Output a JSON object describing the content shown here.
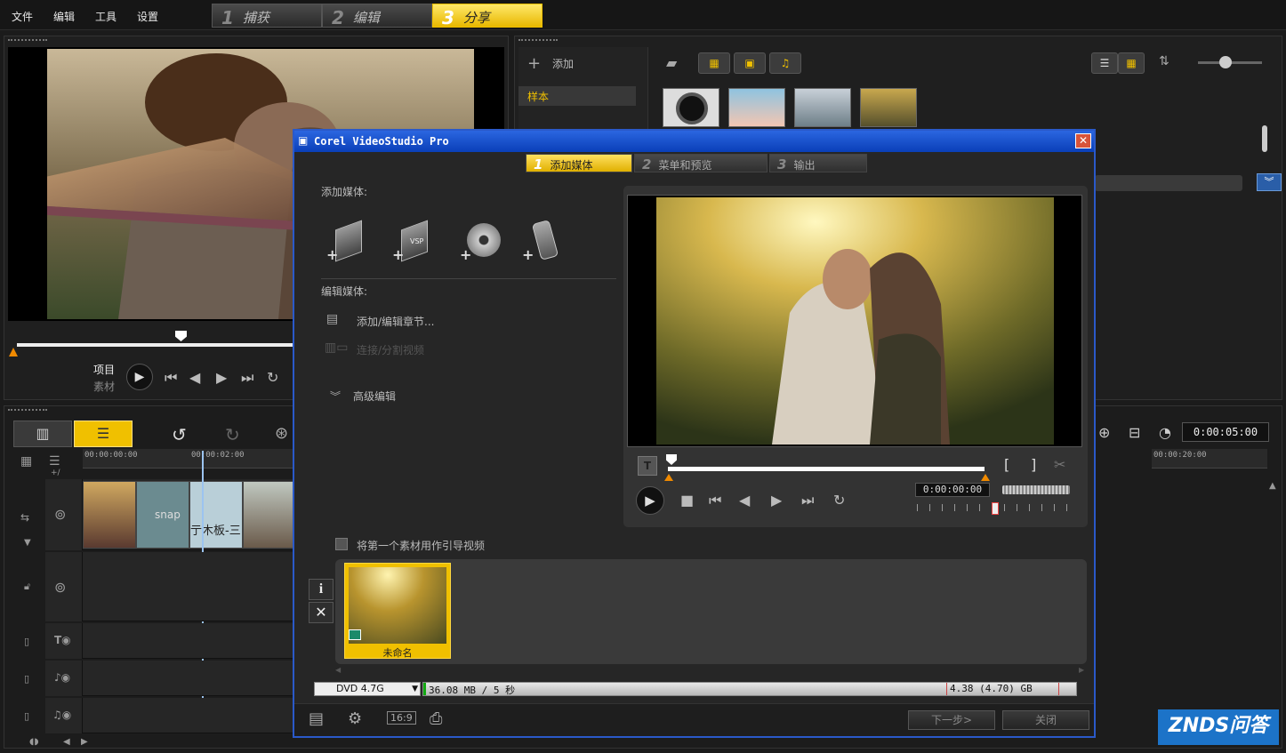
{
  "menubar": {
    "items": [
      "文件",
      "编辑",
      "工具",
      "设置"
    ]
  },
  "steps": [
    {
      "num": "1",
      "label": "捕获"
    },
    {
      "num": "2",
      "label": "编辑"
    },
    {
      "num": "3",
      "label": "分享"
    }
  ],
  "library": {
    "add_label": "添加",
    "folder_label": "样本"
  },
  "player": {
    "project_label": "项目",
    "clip_label": "素材",
    "timecode": "0:00:05:00"
  },
  "timeline": {
    "ruler": [
      "00:00:00:00",
      "00:00:02:00",
      "00:00:20:00"
    ],
    "clip_text_1": "snap",
    "clip_text_2": "亍木板-三",
    "overlay_label": "+/",
    "track_icons": [
      "video-track-icon",
      "overlay-track-icon",
      "title-track-icon",
      "voice-track-icon",
      "music-track-icon"
    ]
  },
  "dialog": {
    "title": "Corel VideoStudio Pro",
    "tabs": [
      {
        "num": "1",
        "label": "添加媒体"
      },
      {
        "num": "2",
        "label": "菜单和预览"
      },
      {
        "num": "3",
        "label": "输出"
      }
    ],
    "add_media_label": "添加媒体:",
    "edit_media_label": "编辑媒体:",
    "chapter_label": "添加/编辑章节...",
    "join_label": "连接/分割视频",
    "advanced_label": "高级编辑",
    "checkbox_label": "将第一个素材用作引导视频",
    "timecode": "0:00:00:00",
    "clip_name": "未命名",
    "disc_type": "DVD 4.7G",
    "usage": "36.08 MB / 5 秒",
    "capacity": "4.38 (4.70) GB",
    "next_label": "下一步>",
    "close_label": "关闭",
    "info_label": "i"
  },
  "watermark": "ZNDS问答",
  "colors": {
    "accent": "#f0c000",
    "title_blue": "#0a3fb8",
    "highlight": "#ffcc00"
  }
}
